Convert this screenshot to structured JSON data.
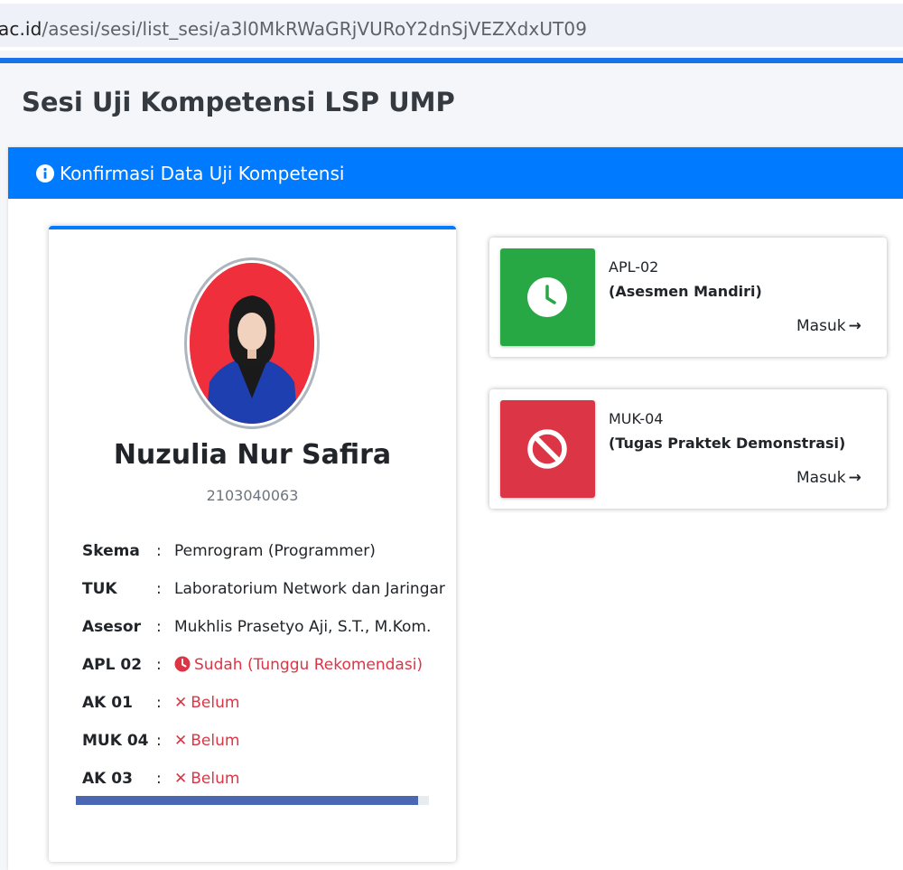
{
  "browser": {
    "url_domain": "ac.id",
    "url_path": "/asesi/sesi/list_sesi/a3l0MkRWaGRjVURoY2dnSjVEZXdxUT09"
  },
  "page": {
    "title": "Sesi Uji Kompetensi LSP UMP"
  },
  "card": {
    "header_icon": "info-circle-icon",
    "header_title": "Konfirmasi Data Uji Kompetensi"
  },
  "profile": {
    "name": "Nuzulia Nur Safira",
    "nim": "2103040063",
    "rows": [
      {
        "label": "Skema",
        "value": "Pemrogram (Programmer)",
        "status": "plain"
      },
      {
        "label": "TUK",
        "value": "Laboratorium Network dan Jaringar",
        "status": "plain"
      },
      {
        "label": "Asesor",
        "value": "Mukhlis Prasetyo Aji, S.T., M.Kom.",
        "status": "plain"
      },
      {
        "label": "APL 02",
        "value": "Sudah (Tunggu Rekomendasi)",
        "status": "waiting",
        "icon": "clock-icon"
      },
      {
        "label": "AK 01",
        "value": "Belum",
        "status": "not-done",
        "icon": "x-icon"
      },
      {
        "label": "MUK 04",
        "value": "Belum",
        "status": "not-done",
        "icon": "x-icon"
      },
      {
        "label": "AK 03",
        "value": "Belum",
        "status": "not-done",
        "icon": "x-icon"
      }
    ],
    "colon": ":",
    "progress_fraction": 0.97
  },
  "tasks": [
    {
      "code": "APL-02",
      "name": "(Asesmen Mandiri)",
      "link": "Masuk",
      "icon": "clock-icon",
      "color": "#28a745"
    },
    {
      "code": "MUK-04",
      "name": "(Tugas Praktek Demonstrasi)",
      "link": "Masuk",
      "icon": "ban-icon",
      "color": "#dc3545"
    }
  ],
  "colors": {
    "primary": "#007bff",
    "success": "#28a745",
    "danger": "#dc3545"
  }
}
